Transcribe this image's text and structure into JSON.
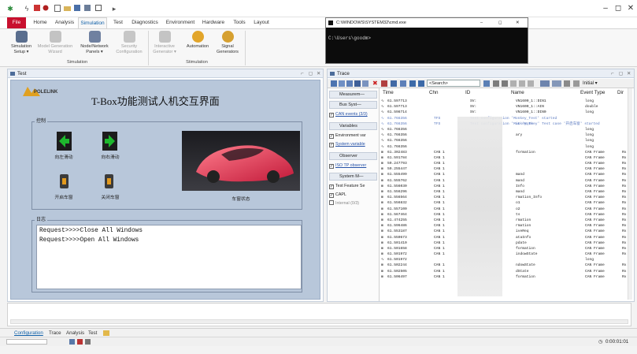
{
  "ribbon_tabs": [
    {
      "label": "File"
    },
    {
      "label": "Home"
    },
    {
      "label": "Analysis"
    },
    {
      "label": "Simulation"
    },
    {
      "label": "Test"
    },
    {
      "label": "Diagnostics"
    },
    {
      "label": "Environment"
    },
    {
      "label": "Hardware"
    },
    {
      "label": "Tools"
    },
    {
      "label": "Layout"
    }
  ],
  "ribbon": {
    "buttons": [
      {
        "label": "Simulation\nSetup ▾",
        "enabled": true
      },
      {
        "label": "Model Generation\nWizard",
        "enabled": false
      },
      {
        "label": "Node/Network\nPanels ▾",
        "enabled": true
      },
      {
        "label": "Security\nConfiguration",
        "enabled": false
      },
      {
        "label": "Interactive\nGenerator ▾",
        "enabled": false
      },
      {
        "label": "Automation",
        "enabled": true
      },
      {
        "label": "Signal\nGenerators",
        "enabled": true
      }
    ],
    "groups": [
      {
        "label": "Simulation"
      },
      {
        "label": "Stimulation"
      }
    ]
  },
  "cmd": {
    "title": "C:\\WINDOWS\\SYSTEM32\\cmd.exe",
    "prompt": "C:\\Users\\goodm>"
  },
  "test_panel": {
    "title": "Test",
    "logo": "POLELINK",
    "heading": "T-Box功能测试人机交互界面",
    "control_group": "控制",
    "controls": [
      {
        "label": "向左滑动"
      },
      {
        "label": "向右滑动"
      },
      {
        "label": "开启车窗"
      },
      {
        "label": "关闭车窗"
      }
    ],
    "car_label": "车窗状态",
    "log_group": "日志",
    "log_lines": [
      "Request>>>>Close All Windows",
      "Request>>>>Open All Windows"
    ]
  },
  "trace_panel": {
    "title": "Trace",
    "search_placeholder": "<Search>",
    "initial_label": "Initial ▾",
    "columns": {
      "time": "Time",
      "chn": "Chn",
      "id": "ID",
      "name": "Name",
      "event_type": "Event Type",
      "dir": "Dir"
    },
    "sidebar": [
      {
        "kind": "header",
        "label": "Measurem—"
      },
      {
        "kind": "header",
        "label": "Bus Syst—"
      },
      {
        "kind": "item",
        "checked": true,
        "label": "CAN events (3/3)",
        "link": true
      },
      {
        "kind": "header",
        "label": "Variables"
      },
      {
        "kind": "item",
        "checked": true,
        "label": "Environment var"
      },
      {
        "kind": "item",
        "checked": true,
        "label": "System variable",
        "link": true
      },
      {
        "kind": "header",
        "label": "Observer"
      },
      {
        "kind": "item",
        "checked": true,
        "label": "ISO TP observer",
        "link": true
      },
      {
        "kind": "header",
        "label": "System M—"
      },
      {
        "kind": "item",
        "checked": true,
        "label": "Test Feature Se"
      },
      {
        "kind": "item",
        "checked": true,
        "label": "CAPL"
      },
      {
        "kind": "item",
        "checked": false,
        "label": "Internal (0/3)",
        "dim": true
      }
    ],
    "rows": [
      {
        "time": "61.597713",
        "chn": "",
        "id": "SV:",
        "name": "VN1600_1::DIN1",
        "event": "long",
        "dir": "",
        "hl": false
      },
      {
        "time": "61.597713",
        "chn": "",
        "id": "SV:",
        "name": "VN1600_1::AIN",
        "event": "double",
        "dir": "",
        "hl": false
      },
      {
        "time": "61.598714",
        "chn": "",
        "id": "SV:",
        "name": "VN1600_1::DIN0",
        "event": "long",
        "dir": "",
        "hl": false
      },
      {
        "time": "61.766356",
        "chn": "TFS",
        "id": "Test configuration 'Monkey_Test' started",
        "name": "",
        "event": "",
        "dir": "",
        "hl": true
      },
      {
        "time": "61.766356",
        "chn": "TFS",
        "id": "Test configuration 'Monkey_Te",
        "name": "it 'Monkey' Test case '开启车窗' started",
        "event": "",
        "dir": "",
        "hl": true
      },
      {
        "time": "61.766356",
        "chn": "",
        "id": "",
        "name": "",
        "event": "long",
        "dir": "",
        "hl": false
      },
      {
        "time": "61.766356",
        "chn": "",
        "id": "",
        "name": "ary",
        "event": "long",
        "dir": "",
        "hl": false
      },
      {
        "time": "61.766356",
        "chn": "",
        "id": "",
        "name": "",
        "event": "long",
        "dir": "",
        "hl": false
      },
      {
        "time": "61.766356",
        "chn": "",
        "id": "",
        "name": "",
        "event": "long",
        "dir": "",
        "hl": false
      },
      {
        "time": "61.302483",
        "chn": "CAN 1",
        "id": "",
        "name": "formation",
        "event": "CAN Frame",
        "dir": "Rx",
        "hl": false
      },
      {
        "time": "61.591784",
        "chn": "CAN 1",
        "id": "",
        "name": "",
        "event": "CAN Frame",
        "dir": "Rx",
        "hl": false
      },
      {
        "time": "59.247793",
        "chn": "CAN 1",
        "id": "",
        "name": "",
        "event": "CAN Frame",
        "dir": "Rx",
        "hl": false
      },
      {
        "time": "59.255447",
        "chn": "CAN 1",
        "id": "",
        "name": "",
        "event": "CAN Frame",
        "dir": "Rx",
        "hl": false
      },
      {
        "time": "61.555499",
        "chn": "CAN 1",
        "id": "",
        "name": "mand",
        "event": "CAN Frame",
        "dir": "Rx",
        "hl": false
      },
      {
        "time": "61.555762",
        "chn": "CAN 1",
        "id": "",
        "name": "mand",
        "event": "CAN Frame",
        "dir": "Rx",
        "hl": false
      },
      {
        "time": "61.556030",
        "chn": "CAN 1",
        "id": "",
        "name": "Info",
        "event": "CAN Frame",
        "dir": "Rx",
        "hl": false
      },
      {
        "time": "61.556296",
        "chn": "CAN 1",
        "id": "",
        "name": "mand",
        "event": "CAN Frame",
        "dir": "Rx",
        "hl": false
      },
      {
        "time": "61.556564",
        "chn": "CAN 1",
        "id": "",
        "name": "rmation_Info",
        "event": "CAN Frame",
        "dir": "Rx",
        "hl": false
      },
      {
        "time": "61.556832",
        "chn": "CAN 1",
        "id": "",
        "name": "o1",
        "event": "CAN Frame",
        "dir": "Rx",
        "hl": false
      },
      {
        "time": "61.557100",
        "chn": "CAN 1",
        "id": "",
        "name": "o2",
        "event": "CAN Frame",
        "dir": "Rx",
        "hl": false
      },
      {
        "time": "61.567464",
        "chn": "CAN 1",
        "id": "",
        "name": "ts",
        "event": "CAN Frame",
        "dir": "Rx",
        "hl": false
      },
      {
        "time": "61.474255",
        "chn": "CAN 1",
        "id": "",
        "name": "rmation",
        "event": "CAN Frame",
        "dir": "Rx",
        "hl": false
      },
      {
        "time": "61.596486",
        "chn": "CAN 1",
        "id": "",
        "name": "rmation",
        "event": "CAN Frame",
        "dir": "Rx",
        "hl": false
      },
      {
        "time": "61.553187",
        "chn": "CAN 1",
        "id": "",
        "name": "iveReq",
        "event": "CAN Frame",
        "dir": "Rx",
        "hl": false
      },
      {
        "time": "61.550673",
        "chn": "CAN 1",
        "id": "",
        "name": "ataInfo",
        "event": "CAN Frame",
        "dir": "Rx",
        "hl": false
      },
      {
        "time": "61.501410",
        "chn": "CAN 1",
        "id": "",
        "name": "pdate",
        "event": "CAN Frame",
        "dir": "Rx",
        "hl": false
      },
      {
        "time": "61.501658",
        "chn": "CAN 1",
        "id": "",
        "name": "formation",
        "event": "CAN Frame",
        "dir": "Rx",
        "hl": false
      },
      {
        "time": "61.501972",
        "chn": "CAN 1",
        "id": "",
        "name": "indowState",
        "event": "CAN Frame",
        "dir": "Rx",
        "hl": false
      },
      {
        "time": "61.501972",
        "chn": "",
        "id": "",
        "name": "",
        "event": "long",
        "dir": "",
        "hl": false
      },
      {
        "time": "61.502244",
        "chn": "CAN 1",
        "id": "",
        "name": "ndowState",
        "event": "CAN Frame",
        "dir": "Rx",
        "hl": false
      },
      {
        "time": "61.502505",
        "chn": "CAN 1",
        "id": "",
        "name": "dState",
        "event": "CAN Frame",
        "dir": "Rx",
        "hl": false
      },
      {
        "time": "61.506497",
        "chn": "CAN 1",
        "id": "",
        "name": "formation",
        "event": "CAN Frame",
        "dir": "Rx",
        "hl": false
      }
    ]
  },
  "bottom_tabs": [
    {
      "label": "Configuration",
      "active": true
    },
    {
      "label": "Trace",
      "active": false
    },
    {
      "label": "Analysis",
      "active": false
    },
    {
      "label": "Test",
      "active": false
    }
  ],
  "status": {
    "time": "0:00:01:01"
  },
  "colors": {
    "accent": "#1060a8",
    "file_tab": "#c8102e",
    "trace_highlight": "#5a79c0"
  }
}
